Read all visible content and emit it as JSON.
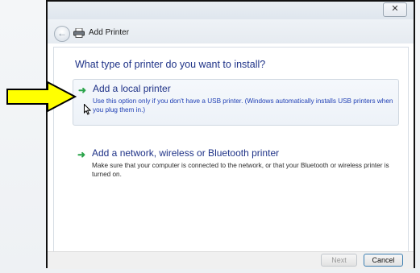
{
  "window": {
    "title": "Add Printer",
    "close_glyph": "✕"
  },
  "main": {
    "question": "What type of printer do you want to install?",
    "options": [
      {
        "title": "Add a local printer",
        "description": "Use this option only if you don't have a USB printer. (Windows automatically installs USB printers when you plug them in.)",
        "icon": "green-arrow-icon"
      },
      {
        "title": "Add a network, wireless or Bluetooth printer",
        "description": "Make sure that your computer is connected to the network, or that your Bluetooth or wireless printer is turned on.",
        "icon": "green-arrow-icon"
      }
    ]
  },
  "footer": {
    "next_label": "Next",
    "cancel_label": "Cancel"
  },
  "annotation": {
    "icon": "yellow-pointer-arrow-icon",
    "color": "#ffff00"
  },
  "colors": {
    "heading_blue": "#1e3287",
    "link_blue": "#1f3fb5",
    "arrow_green": "#2aa44a"
  }
}
